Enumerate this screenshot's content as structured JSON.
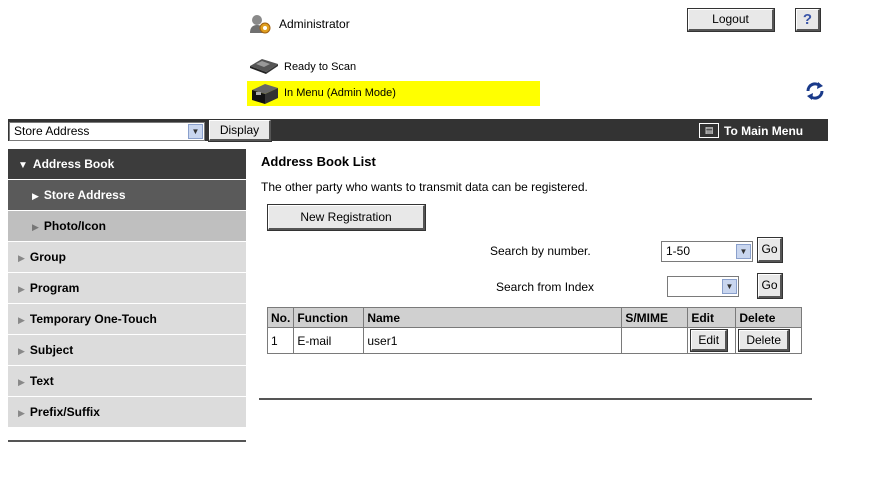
{
  "header": {
    "user_name": "Administrator",
    "logout_label": "Logout",
    "help_label": "?",
    "scan_status": "Ready to Scan",
    "menu_status": "In Menu (Admin Mode)",
    "status_highlight_color": "#ffff00"
  },
  "toolbar": {
    "selected_option": "Store Address",
    "display_label": "Display",
    "main_menu_label": "To Main Menu"
  },
  "sidebar": {
    "header": "Address Book",
    "items": [
      {
        "label": "Store Address",
        "state": "active"
      },
      {
        "label": "Photo/Icon",
        "state": "sub"
      },
      {
        "label": "Group",
        "state": "normal"
      },
      {
        "label": "Program",
        "state": "normal"
      },
      {
        "label": "Temporary One-Touch",
        "state": "normal"
      },
      {
        "label": "Subject",
        "state": "normal"
      },
      {
        "label": "Text",
        "state": "normal"
      },
      {
        "label": "Prefix/Suffix",
        "state": "normal"
      }
    ]
  },
  "main": {
    "title": "Address Book List",
    "description": "The other party who wants to transmit data can be registered.",
    "new_registration_label": "New Registration",
    "search_number_label": "Search by number.",
    "search_number_value": "1-50",
    "search_go_label": "Go",
    "search_index_label": "Search from Index",
    "search_index_value": "",
    "index_go_label": "Go",
    "table": {
      "headers": [
        "No.",
        "Function",
        "Name",
        "S/MIME",
        "Edit",
        "Delete"
      ],
      "rows": [
        {
          "no": "1",
          "function": "E-mail",
          "name": "user1",
          "smime": "",
          "edit_label": "Edit",
          "delete_label": "Delete"
        }
      ]
    }
  },
  "icons": {
    "user": "admin-user-icon",
    "scanner": "scanner-icon",
    "menu_device": "mfp-device-icon",
    "refresh": "refresh-icon",
    "main_menu": "main-menu-icon"
  }
}
